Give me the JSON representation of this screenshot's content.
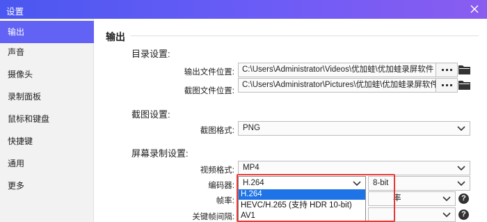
{
  "window": {
    "title": "设置",
    "close_icon": "close-icon"
  },
  "sidebar": {
    "items": [
      {
        "label": "输出",
        "active": true
      },
      {
        "label": "声音"
      },
      {
        "label": "摄像头"
      },
      {
        "label": "录制面板"
      },
      {
        "label": "鼠标和键盘"
      },
      {
        "label": "快捷键"
      },
      {
        "label": "通用"
      },
      {
        "label": "更多"
      }
    ],
    "active_color": "#6262f4"
  },
  "main": {
    "section_title": "输出",
    "directory": {
      "title": "目录设置:",
      "output_label": "输出文件位置:",
      "output_path": "C:\\Users\\Administrator\\Videos\\优加蛙\\优加蛙录屏软件",
      "screenshot_label": "截图文件位置:",
      "screenshot_path": "C:\\Users\\Administrator\\Pictures\\优加蛙\\优加蛙录屏软件",
      "browse_icon": "more-dots-icon",
      "folder_icon": "folder-icon"
    },
    "screenshot": {
      "title": "截图设置:",
      "format_label": "截图格式:",
      "format_value": "PNG"
    },
    "recording": {
      "title": "屏幕录制设置:",
      "video_format_label": "视频格式:",
      "video_format_value": "MP4",
      "encoder_label": "编码器:",
      "encoder_value": "H.264",
      "bitdepth_value": "8-bit",
      "framerate_label": "帧率:",
      "framerate_partial": "率",
      "keyframe_label": "关键帧间隔:"
    },
    "encoder_dropdown": {
      "options": [
        "H.264",
        "HEVC/H.265 (支持 HDR 10-bit)",
        "AV1"
      ],
      "selected_index": 0,
      "highlight_color": "#1e73e6",
      "outline_color": "#e53935"
    }
  }
}
